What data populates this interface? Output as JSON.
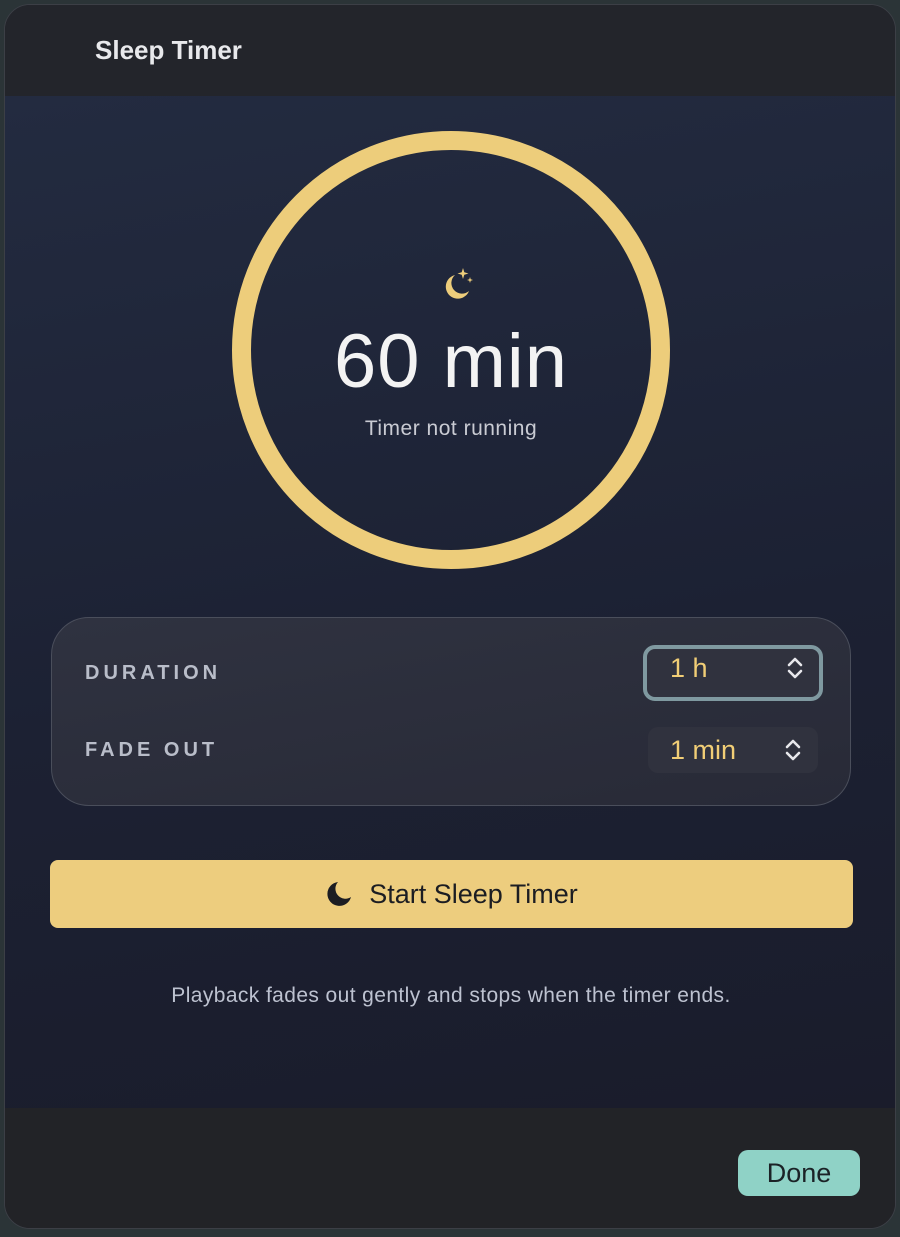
{
  "window": {
    "title": "Sleep Timer"
  },
  "timer": {
    "display": "60 min",
    "status": "Timer not running",
    "icon": "moon-stars-icon",
    "ring_color": "#edcd7b"
  },
  "settings": {
    "duration": {
      "label": "DURATION",
      "value": "1 h"
    },
    "fade_out": {
      "label": "FADE OUT",
      "value": "1 min"
    }
  },
  "start_button": {
    "label": "Start Sleep Timer",
    "icon": "moon-icon",
    "color": "#edcd7e"
  },
  "hint": "Playback fades out gently and stops when the timer ends.",
  "footer": {
    "done_label": "Done",
    "done_color": "#8fd2c6"
  }
}
